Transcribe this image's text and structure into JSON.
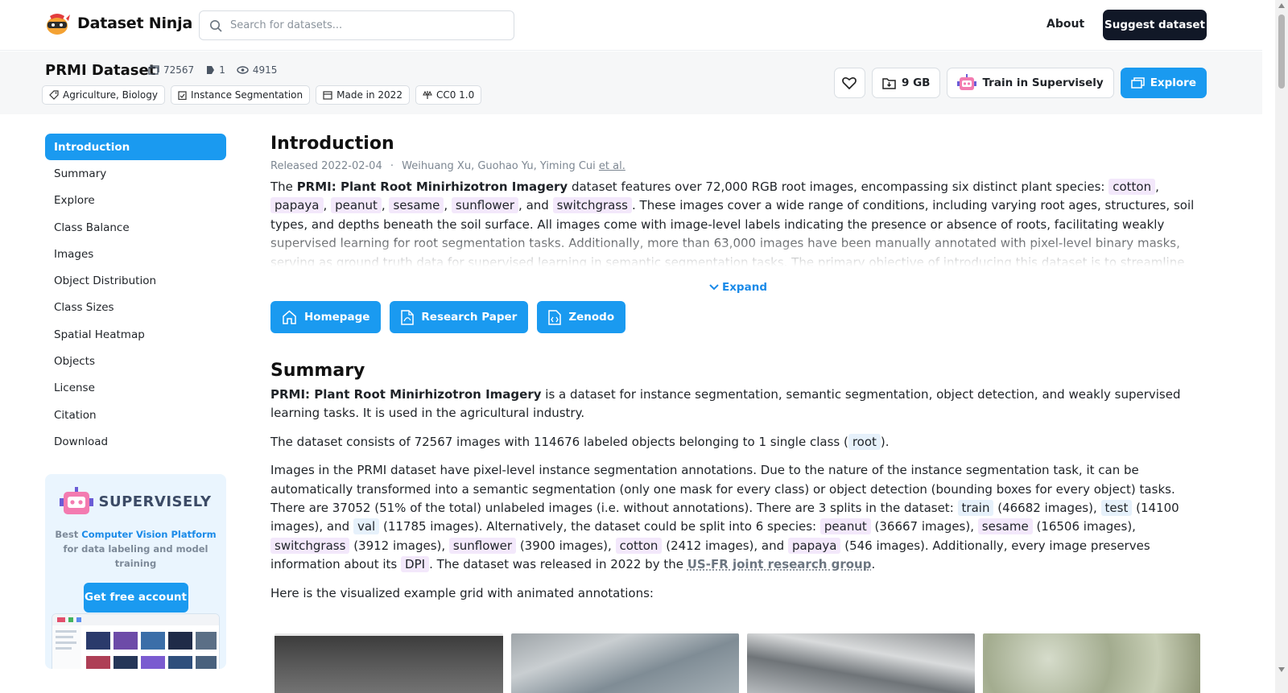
{
  "nav": {
    "brand": "Dataset Ninja",
    "search_placeholder": "Search for datasets...",
    "about": "About",
    "suggest": "Suggest dataset"
  },
  "dataset": {
    "title": "PRMI Dataset",
    "images_count": "72567",
    "classes_count": "1",
    "views_count": "4915",
    "tags": [
      "Agriculture, Biology",
      "Instance Segmentation",
      "Made in 2022",
      "CC0 1.0"
    ],
    "size_label": "9 GB",
    "train_label": "Train in Supervisely",
    "explore_label": "Explore"
  },
  "sidebar": {
    "items": [
      "Introduction",
      "Summary",
      "Explore",
      "Class Balance",
      "Images",
      "Object Distribution",
      "Class Sizes",
      "Spatial Heatmap",
      "Objects",
      "License",
      "Citation",
      "Download"
    ],
    "active_index": 0
  },
  "promo": {
    "word": "SUPERVISELY",
    "text_pre": "Best",
    "text_highlight": "Computer Vision Platform",
    "text_post": "for data labeling and model training",
    "button": "Get free account"
  },
  "intro": {
    "heading": "Introduction",
    "released": "Released 2022-02-04",
    "separator": "·",
    "authors": "Weihuang Xu, Guohao Yu, Yiming Cui",
    "et_al": "et al.",
    "p_the": "The",
    "name_bold": "PRMI: Plant Root Minirhizotron Imagery",
    "p_a": "dataset features over 72,000 RGB root images, encompassing six distinct plant species:",
    "species": [
      "cotton",
      "papaya",
      "peanut",
      "sesame",
      "sunflower",
      "switchgrass"
    ],
    "comma": ",",
    "and": ", and",
    "p_b": ". These images cover a wide range of conditions, including varying root ages, structures, soil types, and depths beneath the soil surface. All images come with image-level labels indicating the presence or absence of roots, facilitating weakly supervised learning for root segmentation tasks. Additionally, more than 63,000 images have been manually annotated with pixel-level binary masks, serving as ground truth data for supervised learning in semantic segmentation tasks. The primary objective of introducing this dataset is to streamline the automatic segmentation of plant roots and advance RSA",
    "expand": "Expand",
    "links": [
      "Homepage",
      "Research Paper",
      "Zenodo"
    ]
  },
  "summary": {
    "heading": "Summary",
    "p1_bold": "PRMI: Plant Root Minirhizotron Imagery",
    "p1_rest": "is a dataset for instance segmentation, semantic segmentation, object detection, and weakly supervised learning tasks. It is used in the agricultural industry.",
    "p2_a": "The dataset consists of 72567 images with 114676 labeled objects belonging to 1 single class (",
    "p2_class": "root",
    "p2_b": ").",
    "p3_a": "Images in the PRMI dataset have pixel-level instance segmentation annotations. Due to the nature of the instance segmentation task, it can be automatically transformed into a semantic segmentation (only one mask for every class) or object detection (bounding boxes for every object) tasks. There are 37052 (51% of the total) unlabeled images (i.e. without annotations). There are 3 splits in the dataset:",
    "split_train": "train",
    "split_train_n": "(46682 images),",
    "split_test": "test",
    "split_test_n": "(14100 images), and",
    "split_val": "val",
    "split_val_n": "(11785 images). Alternatively, the dataset could be split into 6 species:",
    "sp_peanut": "peanut",
    "sp_peanut_n": "(36667 images),",
    "sp_sesame": "sesame",
    "sp_sesame_n": "(16506 images),",
    "sp_switchgrass": "switchgrass",
    "sp_switchgrass_n": "(3912 images),",
    "sp_sunflower": "sunflower",
    "sp_sunflower_n": "(3900 images),",
    "sp_cotton": "cotton",
    "sp_cotton_n": "(2412 images), and",
    "sp_papaya": "papaya",
    "sp_papaya_n": "(546 images). Additionally, every image preserves information about its",
    "dpi": "DPI",
    "p3_end": ". The dataset was released in 2022 by the",
    "org": "US-FR joint research group",
    "p4": "Here is the visualized example grid with animated annotations:"
  },
  "colors": {
    "accent": "#1a9af0",
    "dark": "#111827",
    "tag_purple": "#f3e8fb",
    "tag_blue": "#e6f1fb"
  }
}
